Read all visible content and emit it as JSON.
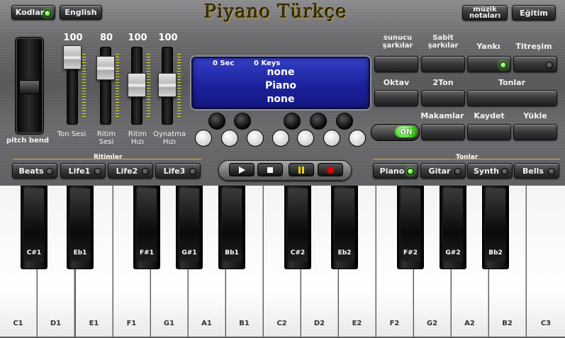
{
  "app": {
    "title": "Piyano Türkçe"
  },
  "top_left": {
    "kodlar": "Kodlar",
    "english": "English"
  },
  "top_right": {
    "muzik_notalari": "müzik notaları",
    "egitim": "Eğitim"
  },
  "sliders": [
    {
      "value": "100",
      "label": "Ton Sesi",
      "level": 0.85
    },
    {
      "value": "80",
      "label": "Ritim Sesi",
      "level": 0.68
    },
    {
      "value": "100",
      "label": "Ritim Hızı",
      "level": 0.42
    },
    {
      "value": "100",
      "label": "Oynatma Hızı",
      "level": 0.42
    }
  ],
  "pitch_bend": {
    "label": "pitch bend"
  },
  "display": {
    "sec": "0 Sec",
    "keys": "0 Keys",
    "line1": "none",
    "line2": "Piano",
    "line3": "none"
  },
  "right_labels": {
    "sunucu_sarkilar": "sunucu şarkılar",
    "sabit_sarkilar": "Sabit şarkılar",
    "yanki": "Yankı",
    "titresim": "Titreşim",
    "oktav": "Oktav",
    "iki_ton": "2Ton",
    "tonlar": "Tonlar",
    "makamlar": "Makamlar",
    "kaydet": "Kaydet",
    "yukle": "Yükle"
  },
  "toggle": {
    "label": "ON"
  },
  "ritimler": {
    "header": "Ritimler",
    "items": [
      "Beats",
      "Life1",
      "Life2",
      "Life3"
    ]
  },
  "tonlar": {
    "header": "Tonlar",
    "items": [
      "Piano",
      "Gitar",
      "Synth",
      "Bells"
    ],
    "active": "Piano"
  },
  "white_keys": [
    "C1",
    "D1",
    "E1",
    "F1",
    "G1",
    "A1",
    "B1",
    "C2",
    "D2",
    "E2",
    "F2",
    "G2",
    "A2",
    "B2",
    "C3"
  ],
  "black_keys": [
    "C#1",
    "Eb1",
    "F#1",
    "G#1",
    "Bb1",
    "C#2",
    "Eb2",
    "F#2",
    "G#2",
    "Bb2"
  ],
  "colors": {
    "led_on": "#45e21a",
    "display_bg": "#1a1f97",
    "title_gold": "#c2a84a",
    "record": "#e00000",
    "pause": "#e8d400"
  }
}
